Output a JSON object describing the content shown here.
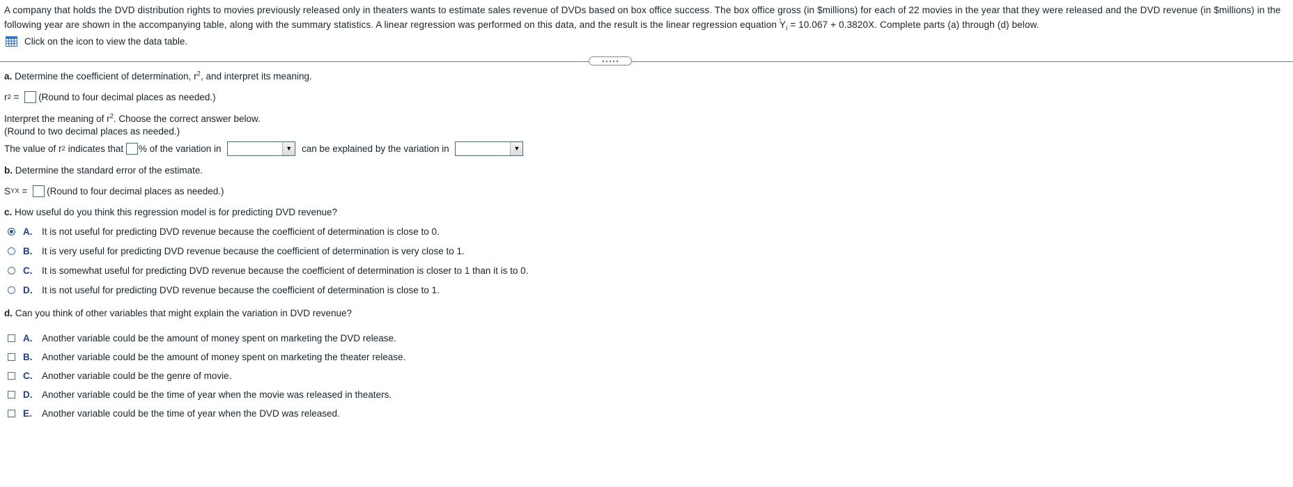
{
  "problem": {
    "statement": "A company that holds the DVD distribution rights to movies previously released only in theaters wants to estimate sales revenue of DVDs based on box office success. The box office gross (in $millions) for each of 22 movies in the year that they were released and the DVD revenue (in $millions) in the following year are shown in the accompanying table, along with the summary statistics. A linear regression was performed on this data, and the result is the linear regression equation Ŷi = 10.067 + 0.3820X. Complete parts (a) through (d) below.",
    "statement_part1": "A company that holds the DVD distribution rights to movies previously released only in theaters wants to estimate sales revenue of DVDs based on box office success. The box office gross (in $millions) for each of 22 movies in the year that they were released and the DVD revenue (in $millions) in the following year are shown in the accompanying table, along with the summary statistics. A linear regression was performed on this data, and the result is the linear regression equation ",
    "equation_symbol": "Y",
    "equation_subscript": "i",
    "statement_part2": " = 10.067 + 0.3820X. Complete parts (a) through (d) below.",
    "datatable_link": "Click on the icon to view the data table.",
    "datatable_icon": "grid-table-icon"
  },
  "splitter": {
    "handle_icon": "splitter-dots-handle"
  },
  "part_a": {
    "letter": "a.",
    "prompt_before": " Determine the coefficient of determination, r",
    "prompt_sup": "2",
    "prompt_after": ", and interpret its meaning.",
    "r2_label": "r",
    "r2_sup": "2",
    "r2_equals": " = ",
    "r2_value": "",
    "r2_hint": "(Round to four decimal places as needed.)",
    "interpret_line_1a": "Interpret the meaning of r",
    "interpret_line_1sup": "2",
    "interpret_line_1b": ". Choose the correct answer below.",
    "interpret_line_2": "(Round to two decimal places as needed.)",
    "value_line_1a": "The value of r",
    "value_line_1sup": "2",
    "value_line_1b": " indicates that ",
    "percent_value": "",
    "value_line_2": "% of the variation in ",
    "dropdown1_value": "",
    "value_line_3": " can be explained by the variation in ",
    "dropdown2_value": "",
    "dropdown_arrow": "▼"
  },
  "part_b": {
    "letter": "b.",
    "prompt": " Determine the standard error of the estimate.",
    "s_label": "S",
    "s_subscript": "YX",
    "s_equals": " = ",
    "s_value": "",
    "s_hint": "(Round to four decimal places as needed.)"
  },
  "part_c": {
    "letter": "c.",
    "prompt": " How useful do you think this regression model is for predicting DVD revenue?",
    "options": [
      {
        "letter": "A.",
        "text": "It is not useful for predicting DVD revenue because the coefficient of determination is close to 0.",
        "selected": true
      },
      {
        "letter": "B.",
        "text": "It is very useful for predicting DVD revenue because the coefficient of determination is very close to 1.",
        "selected": false
      },
      {
        "letter": "C.",
        "text": "It is somewhat useful for predicting DVD revenue because the coefficient of determination is closer to 1 than it is to 0.",
        "selected": false
      },
      {
        "letter": "D.",
        "text": "It is not useful for predicting DVD revenue because the coefficient of determination is close to 1.",
        "selected": false
      }
    ]
  },
  "part_d": {
    "letter": "d.",
    "prompt": " Can you think of other variables that might explain the variation in DVD revenue?",
    "options": [
      {
        "letter": "A.",
        "text": "Another variable could be the amount of money spent on marketing the DVD release.",
        "checked": false
      },
      {
        "letter": "B.",
        "text": "Another variable could be the amount of money spent on marketing the theater release.",
        "checked": false
      },
      {
        "letter": "C.",
        "text": "Another variable could be the genre of movie.",
        "checked": false
      },
      {
        "letter": "D.",
        "text": "Another variable could be the time of year when the movie was released in theaters.",
        "checked": false
      },
      {
        "letter": "E.",
        "text": "Another variable could be the time of year when the DVD was released.",
        "checked": false
      }
    ]
  },
  "colors": {
    "text": "#17232b",
    "option_letter": "#1b3f8b",
    "input_border": "#3c6e7d",
    "control_border": "#4a6fa5",
    "radio_selected": "#1f4e9c",
    "icon_blue": "#3b78c4",
    "splitter": "#6b7b87"
  }
}
